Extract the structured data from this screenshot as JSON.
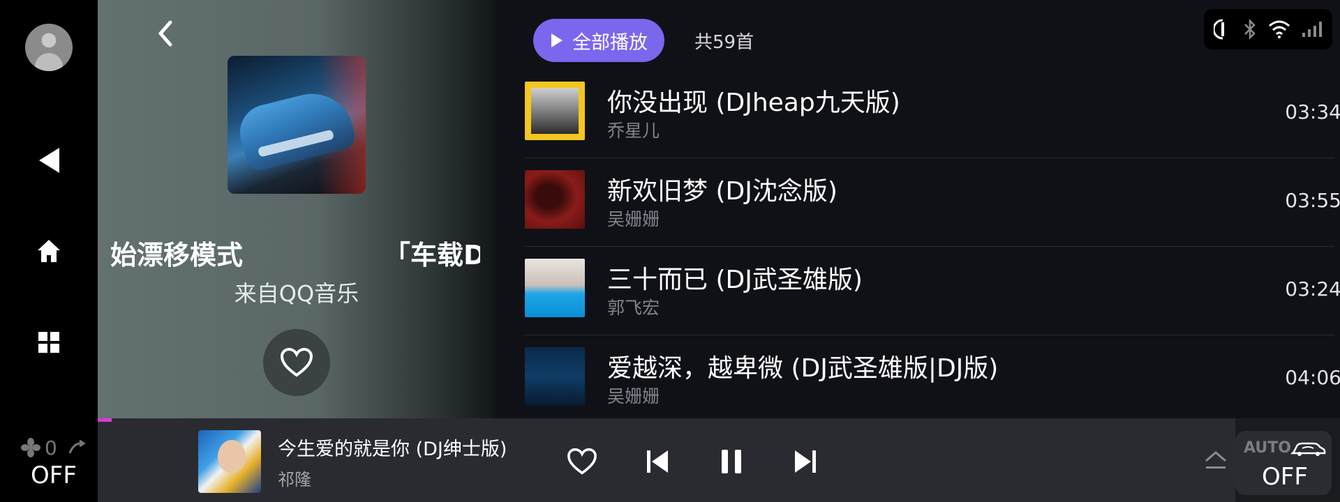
{
  "album": {
    "marquee_left": "始漂移模式",
    "marquee_right": "「车载D",
    "source": "来自QQ音乐"
  },
  "list_header": {
    "play_all_label": "全部播放",
    "count": "共59首"
  },
  "songs": [
    {
      "title": "你没出现 (DJheap九天版)",
      "artist": "乔星儿",
      "duration": "03:34"
    },
    {
      "title": "新欢旧梦 (DJ沈念版)",
      "artist": "吴姗姗",
      "duration": "03:55"
    },
    {
      "title": "三十而已 (DJ武圣雄版)",
      "artist": "郭飞宏",
      "duration": "03:24"
    },
    {
      "title": "爱越深，越卑微 (DJ武圣雄版|DJ版)",
      "artist": "吴姗姗",
      "duration": "04:06"
    }
  ],
  "now_playing": {
    "title": "今生爱的就是你 (DJ绅士版)",
    "artist": "祁隆",
    "progress": 0.012
  },
  "climate_left": {
    "fan_level": "0",
    "status": "OFF"
  },
  "climate_right": {
    "mode": "AUTO",
    "status": "OFF"
  },
  "colors": {
    "accent": "#7b66ee",
    "progress": "#d83be0"
  },
  "icons": [
    "back-icon",
    "home-icon",
    "apps-grid-icon",
    "heart-icon",
    "play-icon",
    "previous-icon",
    "pause-icon",
    "next-icon",
    "wireless-charge-icon",
    "bluetooth-icon",
    "wifi-icon",
    "signal-icon",
    "fan-icon",
    "airflow-icon",
    "car-recirculation-icon",
    "expand-up-icon"
  ]
}
